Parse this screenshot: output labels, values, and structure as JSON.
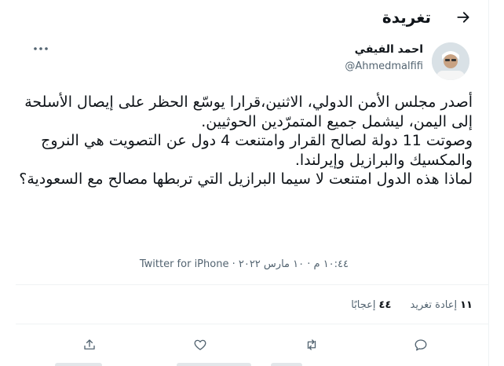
{
  "header": {
    "title": "تغريدة",
    "back_icon": "arrow-right-icon"
  },
  "author": {
    "name": "احمد الفيفي",
    "handle": "@Ahmedmalfifi",
    "avatar_icon": "user-avatar"
  },
  "tweet": {
    "text": "أصدر مجلس الأمن الدولي، الاثنين،قرارا يوسّع الحظر على إيصال الأسلحة إلى اليمن، ليشمل جميع المتمرّدين الحوثيين.\nوصوتت 11 دولة لصالح القرار وامتنعت 4 دول عن التصويت هي النروج والمكسيك والبرازيل وإيرلندا.\nلماذا هذه الدول امتنعت لا سيما البرازيل التي تربطها مصالح مع السعودية؟",
    "timestamp": "١٠:٤٤ م · ١٠ مارس ٢٠٢٢ · ",
    "source": "Twitter for iPhone"
  },
  "stats": {
    "retweets_count": "١١",
    "retweets_label": "إعادة تغريد",
    "likes_count": "٤٤",
    "likes_label": "إعجابًا"
  },
  "actions": [
    "reply-icon",
    "retweet-icon",
    "like-icon",
    "share-icon"
  ],
  "colors": {
    "text": "#0f1419",
    "secondary": "#536471",
    "divider": "#eff3f4",
    "accent": "#1d9bf0"
  }
}
